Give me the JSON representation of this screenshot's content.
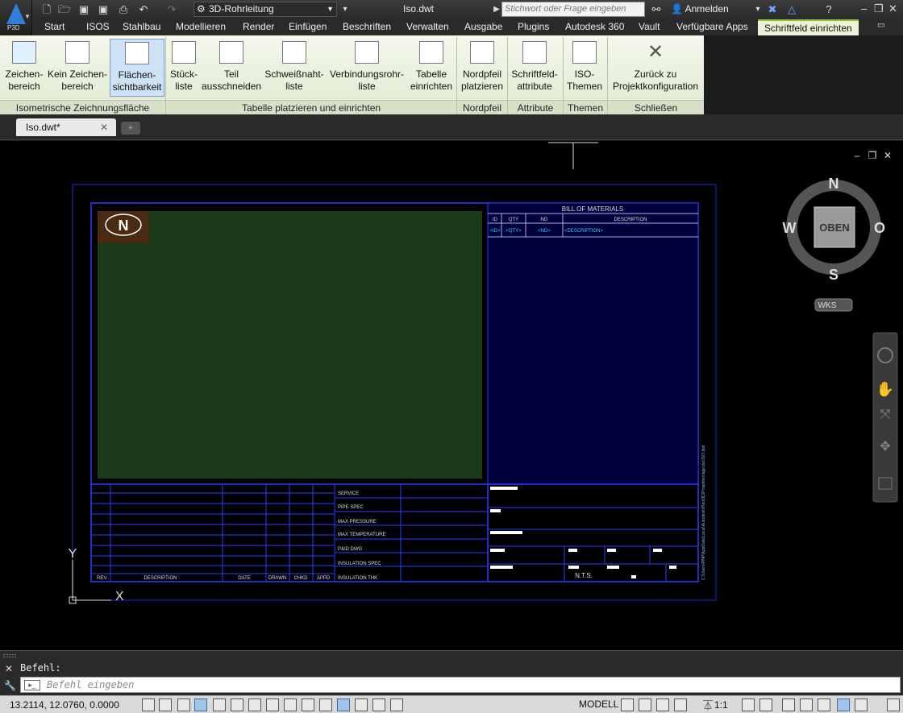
{
  "app": {
    "logo_text": "P3D",
    "workspace": "3D-Rohrleitung",
    "doc_title": "Iso.dwt",
    "search_placeholder": "Stichwort oder Frage eingeben",
    "signin": "Anmelden"
  },
  "menu": [
    "Start",
    "ISOS",
    "Stahlbau",
    "Modellieren",
    "Render",
    "Einfügen",
    "Beschriften",
    "Verwalten",
    "Ausgabe",
    "Plugins",
    "Autodesk 360",
    "Vault",
    "Verfügbare Apps",
    "Schriftfeld einrichten"
  ],
  "ribbon": {
    "buttons": [
      {
        "l1": "Zeichen-",
        "l2": "bereich"
      },
      {
        "l1": "Kein Zeichen-",
        "l2": "bereich"
      },
      {
        "l1": "Flächen-",
        "l2": "sichtbarkeit"
      },
      {
        "l1": "Stück-",
        "l2": "liste"
      },
      {
        "l1": "Teil",
        "l2": "ausschneiden"
      },
      {
        "l1": "Schweißnaht-",
        "l2": "liste"
      },
      {
        "l1": "Verbindungsrohr-",
        "l2": "liste"
      },
      {
        "l1": "Tabelle",
        "l2": "einrichten"
      },
      {
        "l1": "Nordpfeil",
        "l2": "platzieren"
      },
      {
        "l1": "Schriftfeld-",
        "l2": "attribute"
      },
      {
        "l1": "ISO-",
        "l2": "Themen"
      },
      {
        "l1": "Zurück zu",
        "l2": "Projektkonfiguration"
      }
    ],
    "panels": [
      "Isometrische Zeichnungsfläche",
      "Tabelle platzieren und einrichten",
      "Nordpfeil",
      "Attribute",
      "Themen",
      "Schließen"
    ]
  },
  "doctab": {
    "label": "Iso.dwt*"
  },
  "viewcube": {
    "n": "N",
    "s": "S",
    "w": "W",
    "e": "O",
    "top": "OBEN",
    "ucs": "WKS"
  },
  "drawing": {
    "north": "N",
    "bom_title": "BILL OF MATERIALS",
    "bom_headers": [
      "ID",
      "QTY",
      "ND",
      "DESCRIPTION"
    ],
    "bom_row": [
      "<ID>",
      "<QTY>",
      "<ND>",
      "<DESCRIPTION>"
    ],
    "left_headers": [
      "REV.",
      "DESCRIPTION",
      "DATE",
      "DRAWN",
      "CHKD",
      "APPD"
    ],
    "fields": [
      "SERVICE",
      "PIPE SPEC",
      "MAX PRESSURE",
      "MAX TEMPERATURE",
      "P&ID DWG",
      "INSULATION SPEC",
      "INSULATION THK"
    ],
    "nts": "N.T.S.",
    "side_text": "C:\\Users\\PNP\\AppData\\Local\\Autodesk\\Plant3D\\Projektvorlage\\Iso\\ISO.dwt",
    "axis_x": "X",
    "axis_y": "Y"
  },
  "cmd": {
    "history": "Befehl:",
    "placeholder": "Befehl eingeben"
  },
  "status": {
    "coords": "13.2114, 12.0760, 0.0000",
    "model": "MODELL",
    "scale": "1:1"
  }
}
